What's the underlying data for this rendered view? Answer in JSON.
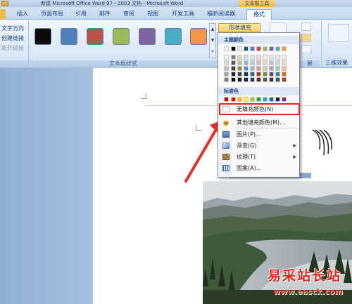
{
  "window": {
    "title": "新建 Microsoft Office Word 97 - 2003 文档 - Microsoft Word",
    "context_tab_title": "文本框工具"
  },
  "tabs": [
    {
      "label": "插入"
    },
    {
      "label": "页面布局"
    },
    {
      "label": "引用"
    },
    {
      "label": "邮件"
    },
    {
      "label": "审阅"
    },
    {
      "label": "视图"
    },
    {
      "label": "开发工具"
    },
    {
      "label": "福昕阅读器"
    },
    {
      "label": "格式"
    }
  ],
  "ribbon": {
    "text_group": {
      "direction": "文字方向",
      "create_link": "创建链接",
      "break_link": "断开链接"
    },
    "styles_group_caption": "文本框样式",
    "style_swatches": [
      {
        "color": "#0b0b0b"
      },
      {
        "color": "#4f81bd"
      },
      {
        "color": "#c0504d"
      },
      {
        "color": "#9bbb59"
      },
      {
        "color": "#8064a2"
      },
      {
        "color": "#4bacc6"
      },
      {
        "color": "#f79646"
      }
    ],
    "shape_fill_label": "形状填充",
    "threed_label": "三维效果",
    "right_caption_fragment": "果"
  },
  "menu": {
    "theme_colors_header": "主题颜色",
    "standard_colors_header": "标准色",
    "theme_top_row": [
      "#ffffff",
      "#000000",
      "#eeece1",
      "#1f497d",
      "#4f81bd",
      "#c0504d",
      "#9bbb59",
      "#8064a2",
      "#4bacc6",
      "#f79646"
    ],
    "theme_shades": [
      [
        "#f2f2f2",
        "#7f7f7f",
        "#ddd9c3",
        "#c6d9f0",
        "#dbe5f1",
        "#f2dcdb",
        "#ebf1dd",
        "#e5e0ec",
        "#dbeef3",
        "#fdeada"
      ],
      [
        "#d8d8d8",
        "#595959",
        "#c4bd97",
        "#8db3e2",
        "#b8cce4",
        "#e5b9b7",
        "#d7e3bc",
        "#ccc1d9",
        "#b7dde8",
        "#fbd5b5"
      ],
      [
        "#bfbfbf",
        "#3f3f3f",
        "#938953",
        "#548dd4",
        "#95b3d7",
        "#d99694",
        "#c3d69b",
        "#b2a2c7",
        "#92cddc",
        "#fac08f"
      ],
      [
        "#a5a5a5",
        "#262626",
        "#494429",
        "#17365d",
        "#366092",
        "#953734",
        "#76923c",
        "#5f497a",
        "#31859b",
        "#e36c09"
      ],
      [
        "#7f7f7f",
        "#0c0c0c",
        "#1d1b10",
        "#0f243e",
        "#244061",
        "#632423",
        "#4f6128",
        "#3f3151",
        "#205867",
        "#974806"
      ]
    ],
    "standard_colors": [
      "#c00000",
      "#ff0000",
      "#ffc000",
      "#ffff00",
      "#92d050",
      "#00b050",
      "#00b0f0",
      "#0070c0",
      "#002060",
      "#7030a0"
    ],
    "items": [
      {
        "label": "无填充颜色(N)",
        "icon": "no-fill-icon"
      },
      {
        "label": "其他填充颜色(M)...",
        "icon": "color-wheel-icon"
      },
      {
        "label": "图片(P)...",
        "icon": "picture-icon"
      },
      {
        "label": "渐变(G)",
        "icon": "gradient-icon"
      },
      {
        "label": "纹理(T)",
        "icon": "texture-icon"
      },
      {
        "label": "图案(A)...",
        "icon": "pattern-icon"
      }
    ]
  },
  "watermark": {
    "main": "易采站长站",
    "url": "www.easck.com"
  }
}
